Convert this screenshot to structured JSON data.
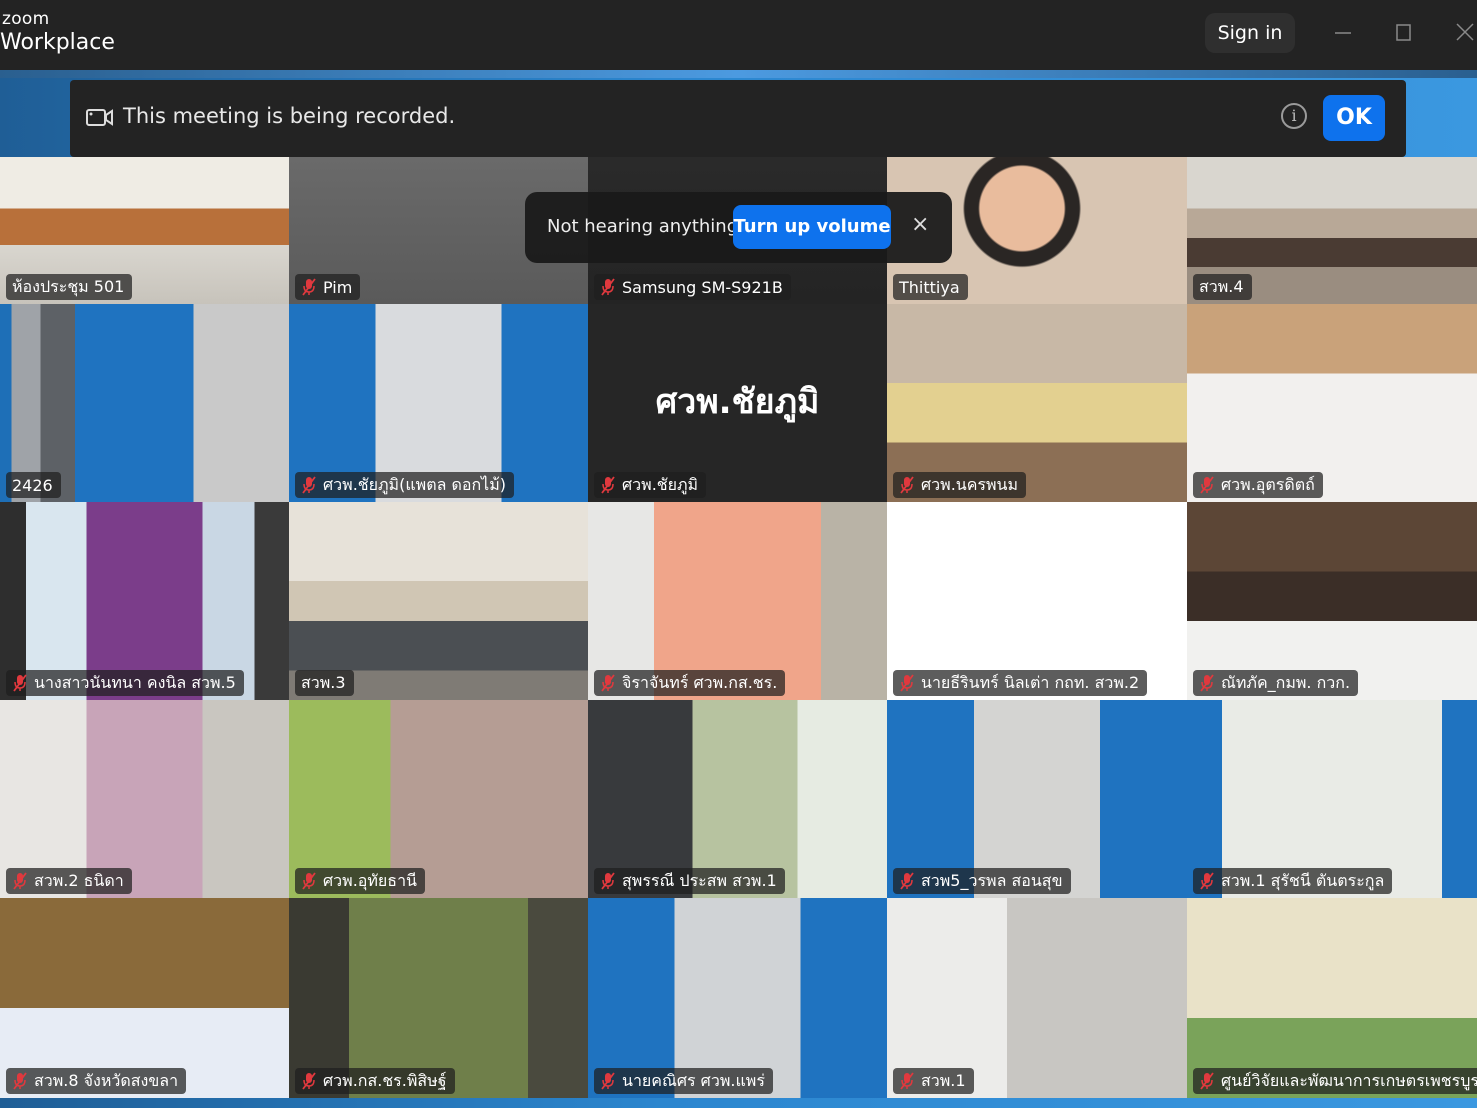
{
  "app": {
    "brand_top": "zoom",
    "brand_bottom": "Workplace",
    "sign_in": "Sign in"
  },
  "window_controls": [
    "minimize-icon",
    "maximize-icon",
    "close-icon"
  ],
  "recording_banner": {
    "message": "This meeting is being recorded.",
    "ok": "OK",
    "icon": "camera-icon",
    "info_icon": "info-icon"
  },
  "audio_banner": {
    "question": "Not hearing anything?",
    "action": "Turn up volume",
    "close": "×"
  },
  "colors": {
    "accent": "#0e72ed",
    "active_speaker": "#1fd26b",
    "muted_icon": "#e0393e"
  },
  "participants": [
    {
      "name": "ห้องประชุม 501",
      "muted": false
    },
    {
      "name": "Pim",
      "muted": true
    },
    {
      "name": "Samsung SM-S921B",
      "muted": true
    },
    {
      "name": "Thittiya",
      "muted": false
    },
    {
      "name": "สวพ.4",
      "muted": false,
      "active": true
    },
    {
      "name": "2426",
      "muted": false
    },
    {
      "name": "ศวพ.ชัยภูมิ(แพตล ดอกไม้)",
      "muted": true
    },
    {
      "name": "ศวพ.ชัยภูมิ",
      "muted": true,
      "display_name": "ศวพ.ชัยภูมิ"
    },
    {
      "name": "ศวพ.นครพนม",
      "muted": true
    },
    {
      "name": "ศวพ.อุตรดิตถ์",
      "muted": true
    },
    {
      "name": "นางสาวนันทนา คงนิล สวพ.5",
      "muted": true
    },
    {
      "name": "สวพ.3",
      "muted": false
    },
    {
      "name": "จิราจันทร์ ศวพ.กส.ชร.",
      "muted": true
    },
    {
      "name": "นายธีรินทร์ นิลเต่า กถท. สวพ.2",
      "muted": true
    },
    {
      "name": "ณัทภัค_กมพ. กวก.",
      "muted": true
    },
    {
      "name": "สวพ.2 ธนิดา",
      "muted": true
    },
    {
      "name": "ศวพ.อุทัยธานี",
      "muted": true
    },
    {
      "name": "สุพรรณี ประสพ สวพ.1",
      "muted": true
    },
    {
      "name": "สวพ5_วรพล สอนสุข",
      "muted": true
    },
    {
      "name": "สวพ.1 สุรัชนี ตันตระกูล",
      "muted": true
    },
    {
      "name": "สวพ.8 จังหวัดสงขลา",
      "muted": true
    },
    {
      "name": "ศวพ.กส.ชร.พิสิษฐ์",
      "muted": true
    },
    {
      "name": "นายคณิศร ศวพ.แพร่",
      "muted": true
    },
    {
      "name": "สวพ.1",
      "muted": true
    },
    {
      "name": "ศูนย์วิจัยและพัฒนาการเกษตรเพชรบูรณ์",
      "muted": true
    }
  ]
}
